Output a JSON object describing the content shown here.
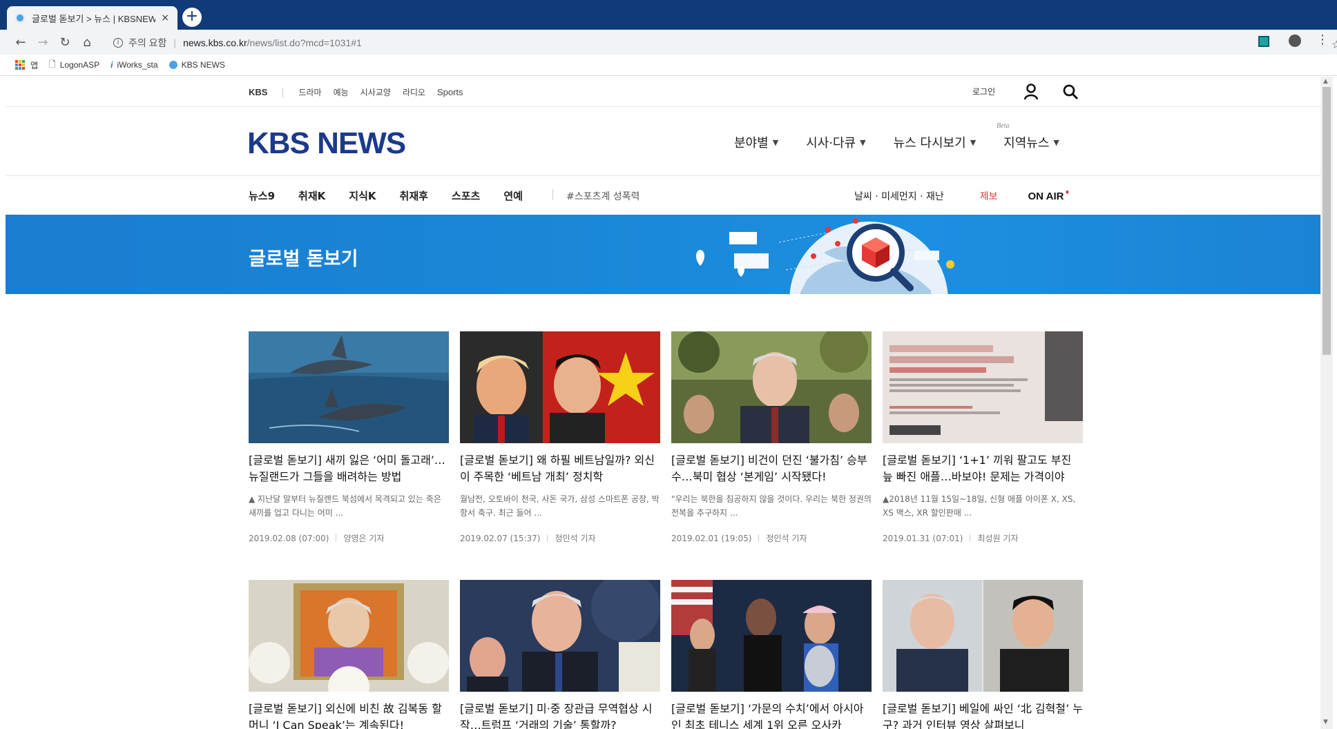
{
  "browser": {
    "tab_title": "글로벌 돋보기 > 뉴스 | KBSNEWS",
    "tab_close": "×",
    "new_tab": "+",
    "url_warning": "주의 요함",
    "url_separator": "|",
    "url_host": "news.kbs.co.kr",
    "url_path": "/news/list.do?mcd=1031#1",
    "bookmarks": [
      {
        "label": "앱",
        "icon": "apps-icon"
      },
      {
        "label": "LogonASP",
        "icon": "page-icon"
      },
      {
        "label": "iWorks_sta",
        "icon": "iworks-icon"
      },
      {
        "label": "KBS NEWS",
        "icon": "kbs-icon"
      }
    ]
  },
  "util": {
    "kbs": "KBS",
    "links": [
      "드라마",
      "예능",
      "시사교양",
      "라디오",
      "Sports"
    ],
    "login": "로그인"
  },
  "gnb": {
    "logo": "KBS NEWS",
    "menu": [
      {
        "label": "분야별"
      },
      {
        "label": "시사·다큐"
      },
      {
        "label": "뉴스 다시보기"
      },
      {
        "label": "지역뉴스",
        "badge": "Beta"
      }
    ],
    "caret": "▼"
  },
  "subnav": {
    "items": [
      "뉴스9",
      "취재K",
      "지식K",
      "취재후",
      "스포츠",
      "연예"
    ],
    "hashtag": "#스포츠계 성폭력",
    "weather": "날씨 · 미세먼지 · 재난",
    "report": "제보",
    "onair": "ON AIR",
    "onair_dot": "●"
  },
  "banner": {
    "title": "글로벌 돋보기"
  },
  "articles": [
    {
      "title": "[글로벌 돋보기] 새끼 잃은 ‘어미 돌고래’…뉴질랜드가 그들을 배려하는 방법",
      "summary": "▲ 지난달 말부터 뉴질랜드 북섬에서 목격되고 있는 죽은 새끼를 업고 다니는 어미 ...",
      "date": "2019.02.08 (07:00)",
      "reporter": "양영은 기자",
      "thumb": "dolphins"
    },
    {
      "title": "[글로벌 돋보기] 왜 하필 베트남일까? 외신이 주목한 ‘베트남 개최’ 정치학",
      "summary": "월남전, 오토바이 천국, 사돈 국가, 삼성 스마트폰 공장, 박항서 축구. 최근 들어 ...",
      "date": "2019.02.07 (15:37)",
      "reporter": "정인석 기자",
      "thumb": "leaders"
    },
    {
      "title": "[글로벌 돋보기] 비건이 던진 ‘불가침’ 승부수…북미 협상 ‘본게임’ 시작됐다!",
      "summary": "\"우리는 북한을 침공하지 않을 것이다. 우리는 북한 정권의 전복을 추구하지 ...",
      "date": "2019.02.01 (19:05)",
      "reporter": "정인석 기자",
      "thumb": "envoy"
    },
    {
      "title": "[글로벌 돋보기] ‘1+1’ 끼워 팔고도 부진 늪 빠진 애플…바보야! 문제는 가격이야",
      "summary": "▲2018년 11월 15일~18일, 신형 애플 아이폰 X, XS, XS 맥스, XR 할인판매 ...",
      "date": "2019.01.31 (07:01)",
      "reporter": "최성원 기자",
      "thumb": "flyer"
    },
    {
      "title": "[글로벌 돋보기] 외신에 비친 故 김복동 할머니 ‘I Can Speak’는 계속된다!",
      "summary": "",
      "date": "",
      "reporter": "",
      "thumb": "portrait"
    },
    {
      "title": "[글로벌 돋보기] 미·중 장관급 무역협상 시작…트럼프 ‘거래의 기술’ 통할까?",
      "summary": "",
      "date": "",
      "reporter": "",
      "thumb": "officials"
    },
    {
      "title": "[글로벌 돋보기] ‘가문의 수치’에서 아시아인 최초 테니스 세계 1위 오른 오사카",
      "summary": "",
      "date": "",
      "reporter": "",
      "thumb": "tennis"
    },
    {
      "title": "[글로벌 돋보기] 베일에 싸인 ‘北 김혁철’ 누구? 과거 인터뷰 영상 살펴보니",
      "summary": "",
      "date": "",
      "reporter": "",
      "thumb": "diplomats"
    }
  ]
}
